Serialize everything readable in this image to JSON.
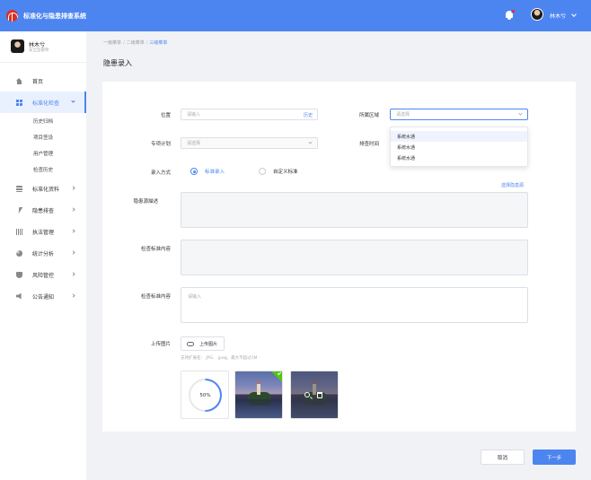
{
  "app": {
    "title": "标准化与隐患排查系统"
  },
  "header": {
    "user_name": "林木兮",
    "notification_count": ""
  },
  "sidebar": {
    "user": {
      "name": "林木兮",
      "role": "安全监察师"
    },
    "items": [
      {
        "label": "首页",
        "icon": "home-icon"
      },
      {
        "label": "标准化检查",
        "icon": "grid-icon",
        "active": true,
        "children": [
          "历史归档",
          "项目签设",
          "用户管理",
          "检查历史"
        ]
      },
      {
        "label": "标准化资料",
        "icon": "stack-icon"
      },
      {
        "label": "隐患排查",
        "icon": "bolt-icon"
      },
      {
        "label": "执法管理",
        "icon": "bars-icon"
      },
      {
        "label": "统计分析",
        "icon": "pie-icon"
      },
      {
        "label": "风险管控",
        "icon": "shield-icon"
      },
      {
        "label": "公告通知",
        "icon": "speaker-icon"
      }
    ]
  },
  "breadcrumb": [
    "一级菜单",
    "二级菜单",
    "三级菜单"
  ],
  "page_title": "隐患录入",
  "form": {
    "location": {
      "label": "位置",
      "placeholder": "请输入",
      "suffix": "历史"
    },
    "area": {
      "label": "所属区域",
      "placeholder": "请选择",
      "options": [
        "系统水通",
        "系统水通",
        "系统水通"
      ]
    },
    "plan": {
      "label": "专项计划",
      "placeholder": "请选择"
    },
    "time": {
      "label": "排查时间"
    },
    "entry_mode": {
      "label": "录入方式",
      "options": [
        "标准录入",
        "自定义标准"
      ],
      "selected": 0
    },
    "select_hazard_link": "选择隐患源",
    "hazard_desc": {
      "label": "隐患源描述"
    },
    "standard_content_1": {
      "label": "检查标准内容"
    },
    "standard_content_2": {
      "label": "检查标准内容",
      "placeholder": "请输入"
    },
    "upload": {
      "label": "上传图片",
      "button": "上传图片",
      "hint": "支持扩展名：.JPG、.jpeg，最大不超过1M",
      "progress": "50%"
    }
  },
  "actions": {
    "cancel": "取消",
    "next": "下一步"
  },
  "colors": {
    "primary": "#4d85f0",
    "success": "#52c41a"
  }
}
